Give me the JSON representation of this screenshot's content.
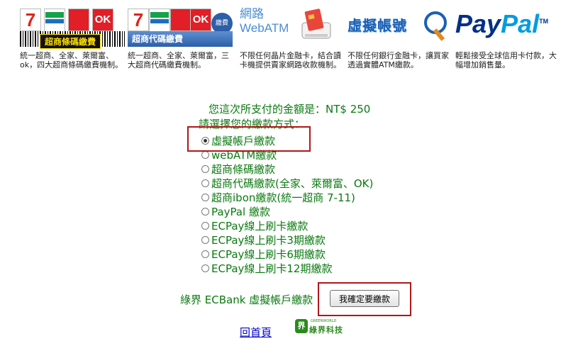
{
  "banner": {
    "cards": [
      {
        "logo_labels": [
          "7",
          "FamilyMart",
          "Hi-Life",
          "OK"
        ],
        "caption": "超商條碼繳費",
        "desc": "統一超商、全家、萊爾富、ok，四大超商條碼繳費機制。"
      },
      {
        "logo_labels": [
          "7",
          "FamilyMart",
          "Hi-Life",
          "OK"
        ],
        "caption": "超商代碼繳費",
        "icon_label": "繳費",
        "desc": "統一超商、全家、萊爾富，三大超商代碼繳費機制。"
      },
      {
        "title_line1": "網路",
        "title_line2": "WebATM",
        "desc": "不限任何晶片金融卡，結合讀卡機提供賣家網路收款機制。"
      },
      {
        "title": "虛擬帳號",
        "desc": "不限任何銀行金融卡，讓買家透過實體ATM繳款。"
      },
      {
        "pay": "Pay",
        "pal": "Pal",
        "tm": "TM",
        "desc": "輕鬆接受全球信用卡付款，大幅增加銷售量。"
      }
    ]
  },
  "amount_text": "您這次所支付的金額是：NT$ 250",
  "choose_text": "請選擇您的繳款方式：",
  "payment_options": [
    {
      "label": "虛擬帳戶繳款",
      "checked": true
    },
    {
      "label": "webATM繳款",
      "checked": false
    },
    {
      "label": "超商條碼繳款",
      "checked": false
    },
    {
      "label": "超商代碼繳款(全家、萊爾富、OK)",
      "checked": false
    },
    {
      "label": "超商ibon繳款(統一超商 7-11)",
      "checked": false
    },
    {
      "label": "PayPal  繳款",
      "checked": false
    },
    {
      "label": "ECPay線上刷卡繳款",
      "checked": false
    },
    {
      "label": "ECPay線上刷卡3期繳款",
      "checked": false
    },
    {
      "label": "ECPay線上刷卡6期繳款",
      "checked": false
    },
    {
      "label": "ECPay線上刷卡12期繳款",
      "checked": false
    }
  ],
  "bottom_label": "綠界 ECBank 虛擬帳戶繳款",
  "submit_label": "我確定要繳款",
  "home_link": "回首頁",
  "ecbank_logo": {
    "leaf": "界",
    "small": "GREENWORLD",
    "name": "綠界科技"
  },
  "colors": {
    "text_green": "#0a7a10",
    "highlight_red": "#b01818",
    "link_blue": "#0000cc"
  }
}
